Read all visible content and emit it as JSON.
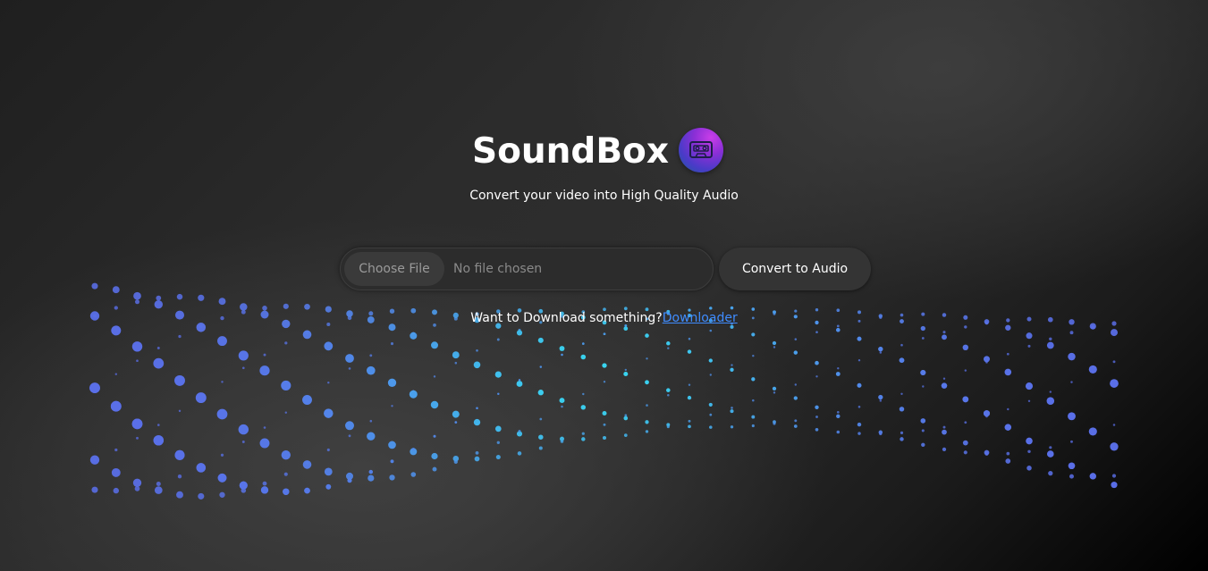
{
  "app": {
    "title": "SoundBox",
    "subtitle": "Convert your video into High Quality Audio",
    "logo_icon": "cassette-tape-icon"
  },
  "file_input": {
    "button_label": "Choose File",
    "status_text": "No file chosen"
  },
  "convert": {
    "label": "Convert to Audio"
  },
  "download": {
    "prompt": "Want to Download something?",
    "link_label": "Downloader"
  },
  "colors": {
    "background_dark": "#000000",
    "background_mid": "#2e2e2e",
    "wave_cyan": "#39d5f0",
    "wave_blue": "#5a6ee8",
    "link": "#3f8cff",
    "logo_pink": "#c93ee8",
    "logo_blue": "#1c5c9a"
  }
}
